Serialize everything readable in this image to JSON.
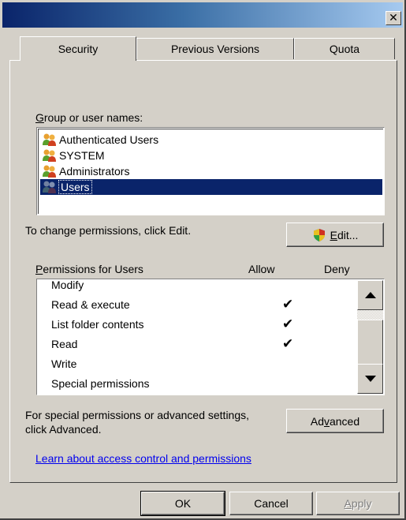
{
  "window": {
    "title": "",
    "close_glyph": "✕"
  },
  "tabs": [
    {
      "label": "Security",
      "active": true
    },
    {
      "label": "Previous Versions",
      "active": false
    },
    {
      "label": "Quota",
      "active": false
    }
  ],
  "group_label": {
    "accel": "G",
    "rest": "roup or user names:"
  },
  "users": [
    {
      "name": "Authenticated Users",
      "selected": false
    },
    {
      "name": "SYSTEM",
      "selected": false
    },
    {
      "name": "Administrators",
      "selected": false
    },
    {
      "name": "Users",
      "selected": true
    }
  ],
  "change_text": "To change permissions, click Edit.",
  "edit_button": {
    "accel": "E",
    "rest": "dit..."
  },
  "permissions_label": {
    "accel": "P",
    "rest": "ermissions for Users"
  },
  "allow_header": "Allow",
  "deny_header": "Deny",
  "permissions": [
    {
      "name": "Modify",
      "allow": "",
      "deny": ""
    },
    {
      "name": "Read & execute",
      "allow": "✔",
      "deny": ""
    },
    {
      "name": "List folder contents",
      "allow": "✔",
      "deny": ""
    },
    {
      "name": "Read",
      "allow": "✔",
      "deny": ""
    },
    {
      "name": "Write",
      "allow": "",
      "deny": ""
    },
    {
      "name": "Special permissions",
      "allow": "",
      "deny": ""
    }
  ],
  "advanced_text_1": "For special permissions or advanced settings,",
  "advanced_text_2": "click Advanced.",
  "advanced_button": {
    "pre": "Ad",
    "accel": "v",
    "post": "anced"
  },
  "learn_link": "Learn about access control and permissions",
  "ok_label": "OK",
  "cancel_label": "Cancel",
  "apply_button": {
    "accel": "A",
    "rest": "pply"
  },
  "colors": {
    "selection": "#0a246a",
    "face": "#d4d0c8",
    "link": "#0000ee"
  }
}
